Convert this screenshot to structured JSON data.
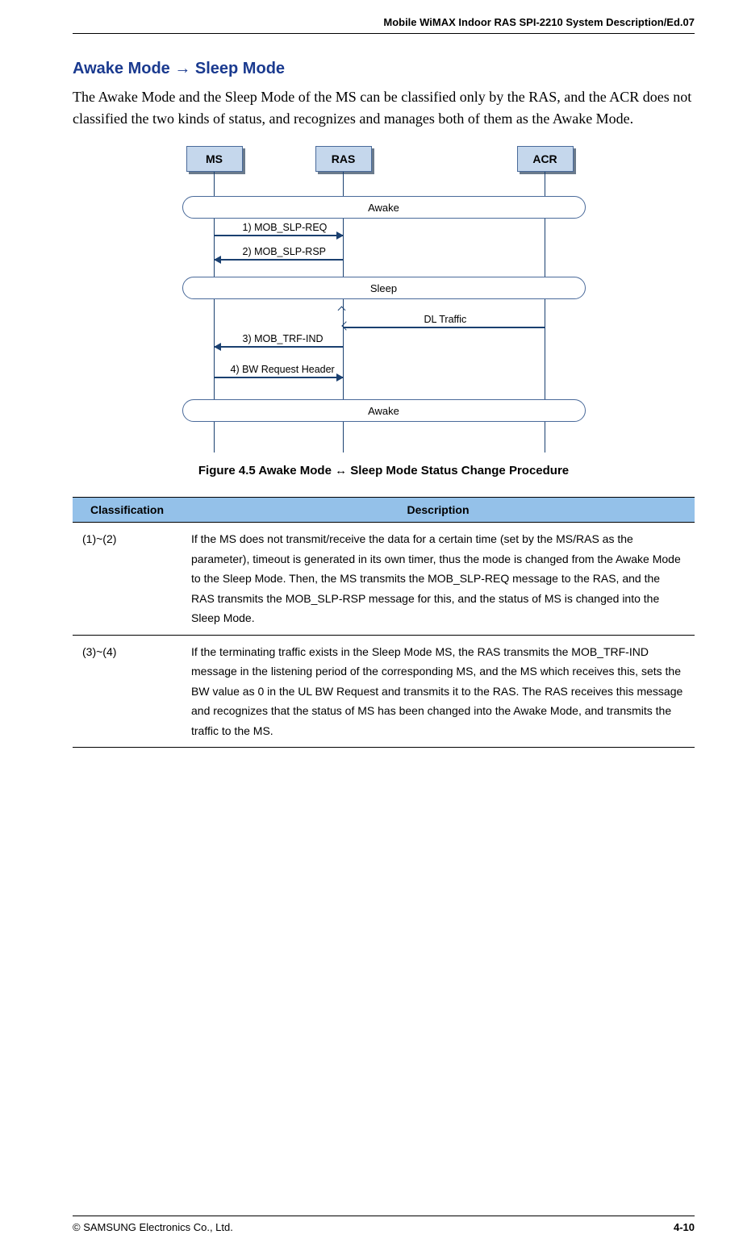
{
  "header": {
    "doc_title": "Mobile WiMAX Indoor RAS SPI-2210 System Description/Ed.07"
  },
  "section": {
    "heading": "Awake Mode → Sleep Mode",
    "paragraph": "The Awake Mode and the Sleep Mode of the MS can be classified only by the RAS, and the ACR does not classified the two kinds of status, and recognizes and manages both of them as the Awake Mode."
  },
  "diagram": {
    "actors": {
      "ms": "MS",
      "ras": "RAS",
      "acr": "ACR"
    },
    "states": {
      "awake1": "Awake",
      "sleep": "Sleep",
      "awake2": "Awake"
    },
    "messages": {
      "m1": "1) MOB_SLP-REQ",
      "m2": "2) MOB_SLP-RSP",
      "m3": "3) MOB_TRF-IND",
      "m4": "4) BW Request Header",
      "dl": "DL Traffic"
    }
  },
  "figure_caption": "Figure 4.5    Awake Mode ↔ Sleep Mode Status Change Procedure",
  "table": {
    "headers": {
      "col1": "Classification",
      "col2": "Description"
    },
    "rows": [
      {
        "classification": "(1)~(2)",
        "description": "If the MS does not transmit/receive the data for a certain time (set by the MS/RAS as the parameter), timeout is generated in its own timer, thus the mode is changed from the Awake Mode to the Sleep Mode. Then, the MS transmits the MOB_SLP-REQ message to the RAS, and the RAS transmits the MOB_SLP-RSP message for this, and the status of MS is changed into the Sleep Mode."
      },
      {
        "classification": "(3)~(4)",
        "description": "If the terminating traffic exists in the Sleep Mode MS, the RAS transmits the MOB_TRF-IND message in the listening period of the corresponding MS, and the MS which receives this, sets the BW value as 0 in the UL BW Request and transmits it to the RAS. The RAS receives this message and recognizes that the status of MS has been changed into the Awake Mode, and transmits the traffic to the MS."
      }
    ]
  },
  "footer": {
    "copyright": "© SAMSUNG Electronics Co., Ltd.",
    "page": "4-10"
  }
}
